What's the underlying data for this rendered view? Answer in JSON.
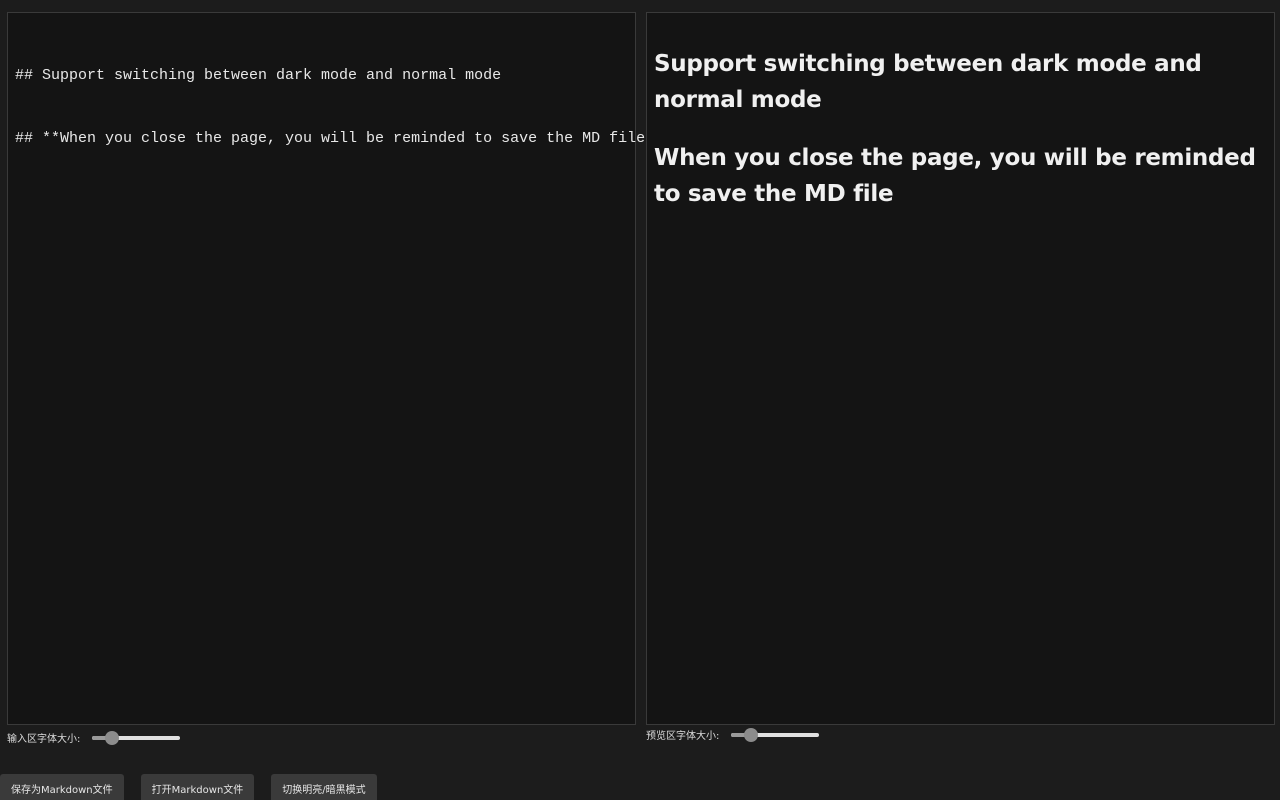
{
  "editor": {
    "lines": [
      "## Support switching between dark mode and normal mode",
      "## **When you close the page, you will be reminded to save the MD file**"
    ]
  },
  "preview": {
    "headings": [
      "Support switching between dark mode and normal mode",
      "When you close the page, you will be reminded to save the MD file"
    ]
  },
  "controls": {
    "input_font_label": "输入区字体大小:",
    "input_font_level": 0.22,
    "preview_font_label": "预览区字体大小:",
    "preview_font_level": 0.22
  },
  "toolbar": {
    "save_label": "保存为Markdown文件",
    "open_label": "打开Markdown文件",
    "toggle_label": "切换明亮/暗黑模式"
  },
  "colors": {
    "background": "#1c1c1c",
    "pane": "#141414",
    "button": "#3a3a3a",
    "text": "#e6e6e6"
  }
}
